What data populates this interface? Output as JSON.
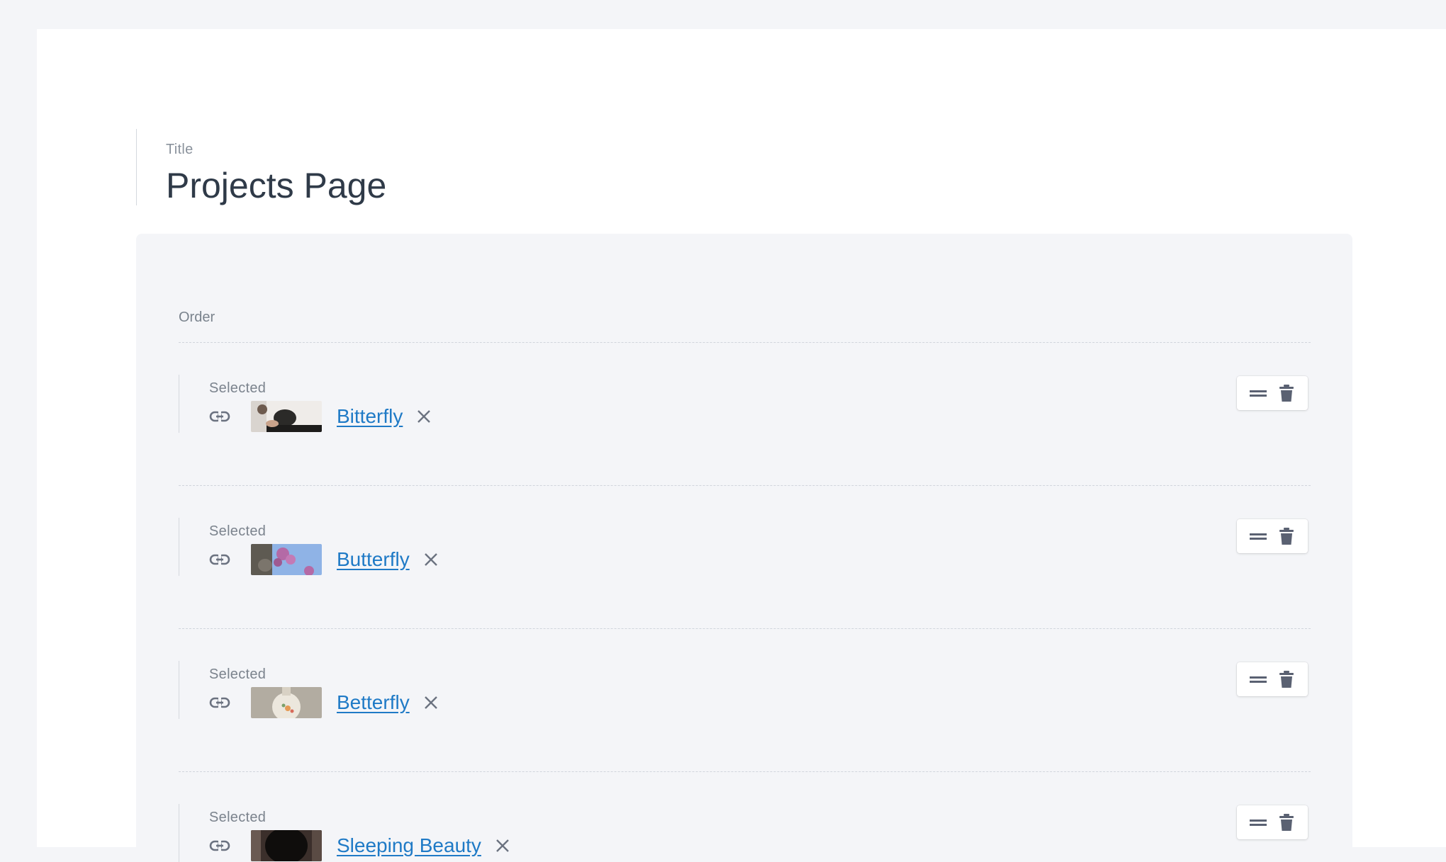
{
  "title_field": {
    "label": "Title",
    "value": "Projects Page"
  },
  "order": {
    "label": "Order",
    "items": [
      {
        "label": "Selected",
        "title": "Bitterfly",
        "thumb_colors": [
          "#d9d4cf",
          "#2b2a28",
          "#efece9"
        ]
      },
      {
        "label": "Selected",
        "title": "Butterfly",
        "thumb_colors": [
          "#8fb3e6",
          "#b46aa6",
          "#5e5a52"
        ]
      },
      {
        "label": "Selected",
        "title": "Betterfly",
        "thumb_colors": [
          "#b2aca1",
          "#ece7dd",
          "#e59a55"
        ]
      },
      {
        "label": "Selected",
        "title": "Sleeping Beauty",
        "thumb_colors": [
          "#3b2f2b",
          "#0f0d0c",
          "#6a5a52"
        ]
      }
    ]
  },
  "colors": {
    "link": "#1f7ac6",
    "icon": "#6b7280",
    "action_icon": "#5a6172"
  },
  "icons": {
    "link": "link-icon",
    "remove": "close-icon",
    "drag": "drag-handle-icon",
    "delete": "trash-icon"
  }
}
